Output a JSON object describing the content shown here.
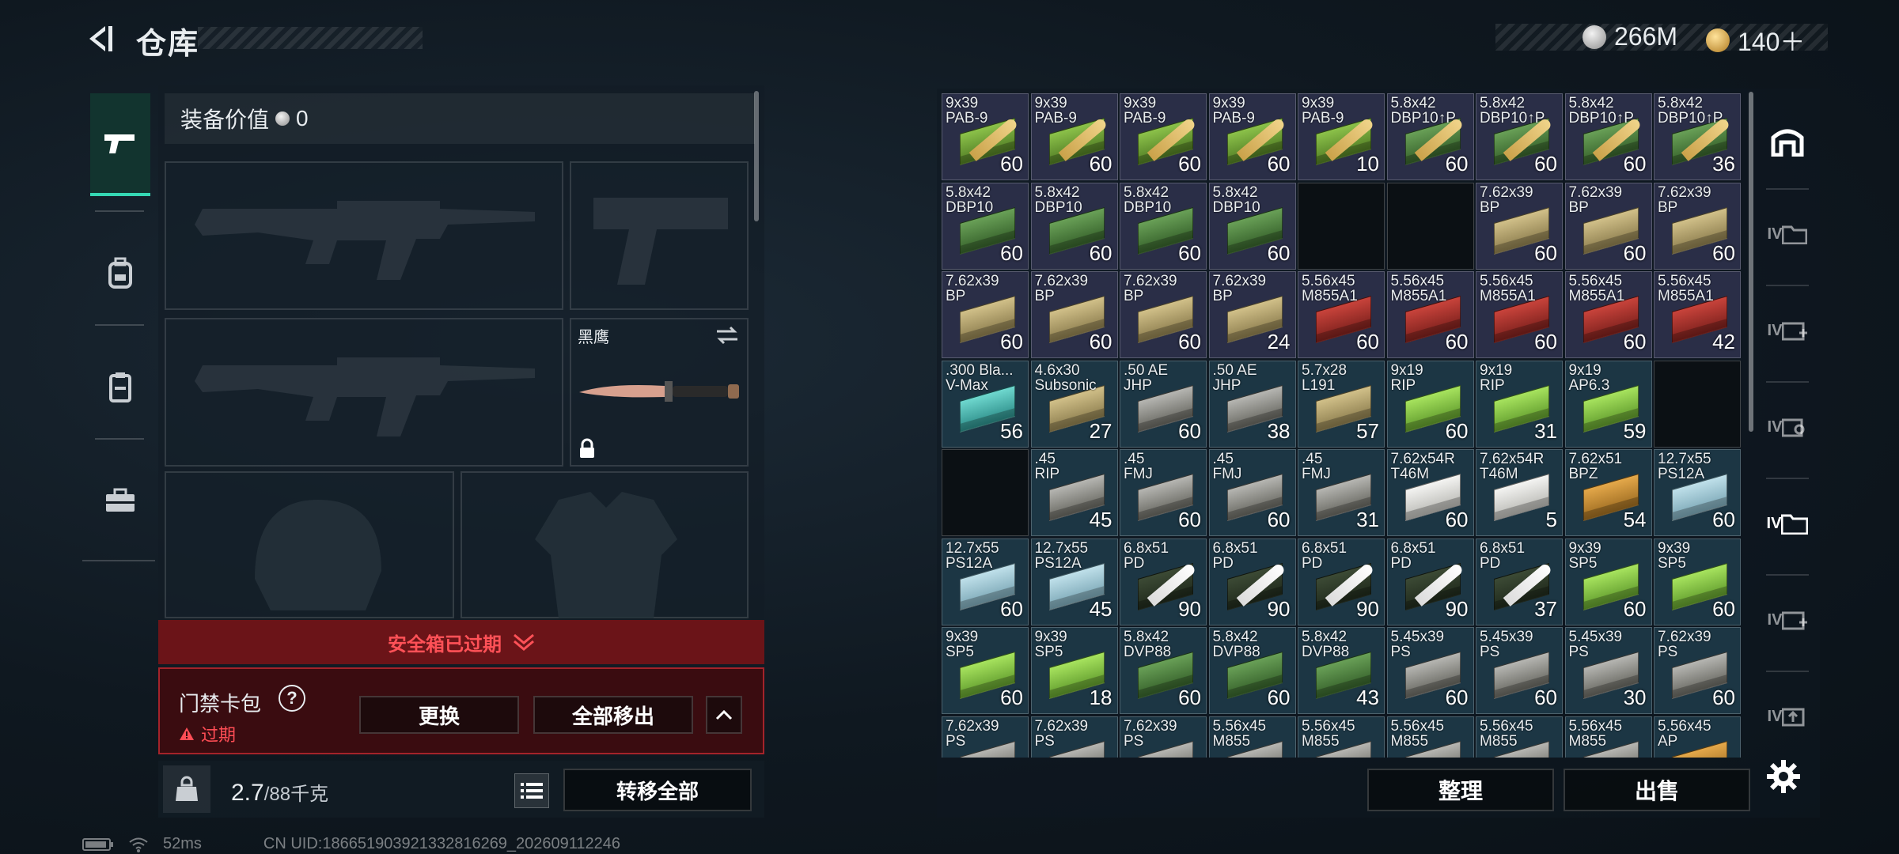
{
  "header": {
    "title": "仓库"
  },
  "currency": {
    "silver": {
      "icon": "silver-coin-icon",
      "value": "266M"
    },
    "gold": {
      "icon": "gold-coin-icon",
      "value": "140＋"
    }
  },
  "left_nav": [
    {
      "icon": "pistol-icon",
      "active": true
    },
    {
      "icon": "backpack-icon",
      "active": false
    },
    {
      "icon": "clipboard-icon",
      "active": false
    },
    {
      "icon": "toolbox-icon",
      "active": false
    }
  ],
  "loadout": {
    "value_label": "装备价值",
    "value": "0",
    "knife_label": "黑鹰"
  },
  "safebox": {
    "expired_text": "安全箱已过期"
  },
  "keybag": {
    "title": "门禁卡包",
    "help": "?",
    "status": "过期",
    "replace_label": "更换",
    "move_all_label": "全部移出"
  },
  "weight": {
    "current": "2.7",
    "max": "/88千克",
    "icon_label": "KG"
  },
  "transfer_all_label": "转移全部",
  "status_bar": {
    "ping": "52ms",
    "uid": "CN UID:186651903921332816269_202609112246"
  },
  "grid_actions": {
    "sort_label": "整理",
    "sell_label": "出售"
  },
  "right_nav": [
    {
      "icon": "safebox-icon",
      "label": ""
    },
    {
      "icon": "storage-iv-icon",
      "label": "IV"
    },
    {
      "icon": "storage-add-icon",
      "label": "IV"
    },
    {
      "icon": "storage-search-icon",
      "label": "IV"
    },
    {
      "icon": "storage-active-icon",
      "label": "IV"
    },
    {
      "icon": "storage-add-2-icon",
      "label": "IV"
    },
    {
      "icon": "storage-upload-icon",
      "label": "IV"
    }
  ],
  "inventory": [
    {
      "name": "9x39\nPAB-9",
      "qty": "60",
      "color": "purple",
      "box": "g",
      "bullet": "gold"
    },
    {
      "name": "9x39\nPAB-9",
      "qty": "60",
      "color": "purple",
      "box": "g",
      "bullet": "gold"
    },
    {
      "name": "9x39\nPAB-9",
      "qty": "60",
      "color": "purple",
      "box": "g",
      "bullet": "gold"
    },
    {
      "name": "9x39\nPAB-9",
      "qty": "60",
      "color": "purple",
      "box": "g",
      "bullet": "gold"
    },
    {
      "name": "9x39\nPAB-9",
      "qty": "10",
      "color": "purple",
      "box": "g",
      "bullet": "gold"
    },
    {
      "name": "5.8x42\nDBP10↑P",
      "qty": "60",
      "color": "purple",
      "box": "dg",
      "bullet": "gold"
    },
    {
      "name": "5.8x42\nDBP10↑P",
      "qty": "60",
      "color": "purple",
      "box": "dg",
      "bullet": "gold"
    },
    {
      "name": "5.8x42\nDBP10↑P",
      "qty": "60",
      "color": "purple",
      "box": "dg",
      "bullet": "gold"
    },
    {
      "name": "5.8x42\nDBP10↑P",
      "qty": "36",
      "color": "purple",
      "box": "dg",
      "bullet": "gold"
    },
    {
      "name": "5.8x42\nDBP10",
      "qty": "60",
      "color": "purple",
      "box": "dg"
    },
    {
      "name": "5.8x42\nDBP10",
      "qty": "60",
      "color": "purple",
      "box": "dg"
    },
    {
      "name": "5.8x42\nDBP10",
      "qty": "60",
      "color": "purple",
      "box": "dg"
    },
    {
      "name": "5.8x42\nDBP10",
      "qty": "60",
      "color": "purple",
      "box": "dg"
    },
    {
      "name": "",
      "qty": "",
      "color": "empty"
    },
    {
      "name": "",
      "qty": "",
      "color": "empty"
    },
    {
      "name": "7.62x39\nBP",
      "qty": "60",
      "color": "purple",
      "box": "t"
    },
    {
      "name": "7.62x39\nBP",
      "qty": "60",
      "color": "purple",
      "box": "t"
    },
    {
      "name": "7.62x39\nBP",
      "qty": "60",
      "color": "purple",
      "box": "t"
    },
    {
      "name": "7.62x39\nBP",
      "qty": "60",
      "color": "purple",
      "box": "t"
    },
    {
      "name": "7.62x39\nBP",
      "qty": "60",
      "color": "purple",
      "box": "t"
    },
    {
      "name": "7.62x39\nBP",
      "qty": "60",
      "color": "purple",
      "box": "t"
    },
    {
      "name": "7.62x39\nBP",
      "qty": "24",
      "color": "purple",
      "box": "t"
    },
    {
      "name": "5.56x45\nM855A1",
      "qty": "60",
      "color": "purple",
      "box": "r"
    },
    {
      "name": "5.56x45\nM855A1",
      "qty": "60",
      "color": "purple",
      "box": "r"
    },
    {
      "name": "5.56x45\nM855A1",
      "qty": "60",
      "color": "purple",
      "box": "r"
    },
    {
      "name": "5.56x45\nM855A1",
      "qty": "60",
      "color": "purple",
      "box": "r"
    },
    {
      "name": "5.56x45\nM855A1",
      "qty": "42",
      "color": "purple",
      "box": "r"
    },
    {
      "name": ".300 Bla...\nV-Max",
      "qty": "56",
      "color": "blue",
      "box": "tl"
    },
    {
      "name": "4.6x30\nSubsonic",
      "qty": "27",
      "color": "blue",
      "box": "t"
    },
    {
      "name": ".50 AE\nJHP",
      "qty": "60",
      "color": "blue",
      "box": "gr"
    },
    {
      "name": ".50 AE\nJHP",
      "qty": "38",
      "color": "blue",
      "box": "gr"
    },
    {
      "name": "5.7x28\nL191",
      "qty": "57",
      "color": "blue",
      "box": "t"
    },
    {
      "name": "9x19\nRIP",
      "qty": "60",
      "color": "blue",
      "box": "lg"
    },
    {
      "name": "9x19\nRIP",
      "qty": "31",
      "color": "blue",
      "box": "lg"
    },
    {
      "name": "9x19\nAP6.3",
      "qty": "59",
      "color": "blue",
      "box": "lg"
    },
    {
      "name": "",
      "qty": "",
      "color": "empty"
    },
    {
      "name": "",
      "qty": "",
      "color": "empty"
    },
    {
      "name": ".45\nRIP",
      "qty": "45",
      "color": "blue",
      "box": "gr"
    },
    {
      "name": ".45\nFMJ",
      "qty": "60",
      "color": "blue",
      "box": "gr"
    },
    {
      "name": ".45\nFMJ",
      "qty": "60",
      "color": "blue",
      "box": "gr"
    },
    {
      "name": ".45\nFMJ",
      "qty": "31",
      "color": "blue",
      "box": "gr"
    },
    {
      "name": "7.62x54R\nT46M",
      "qty": "60",
      "color": "blue",
      "box": "w"
    },
    {
      "name": "7.62x54R\nT46M",
      "qty": "5",
      "color": "blue",
      "box": "w"
    },
    {
      "name": "7.62x51\nBPZ",
      "qty": "54",
      "color": "blue",
      "box": "o"
    },
    {
      "name": "12.7x55\nPS12A",
      "qty": "60",
      "color": "blue",
      "box": "lb"
    },
    {
      "name": "12.7x55\nPS12A",
      "qty": "60",
      "color": "blue",
      "box": "lb"
    },
    {
      "name": "12.7x55\nPS12A",
      "qty": "45",
      "color": "blue",
      "box": "lb"
    },
    {
      "name": "6.8x51\nPD",
      "qty": "90",
      "color": "blue",
      "box": "dk",
      "bullet": "white"
    },
    {
      "name": "6.8x51\nPD",
      "qty": "90",
      "color": "blue",
      "box": "dk",
      "bullet": "white"
    },
    {
      "name": "6.8x51\nPD",
      "qty": "90",
      "color": "blue",
      "box": "dk",
      "bullet": "white"
    },
    {
      "name": "6.8x51\nPD",
      "qty": "90",
      "color": "blue",
      "box": "dk",
      "bullet": "white"
    },
    {
      "name": "6.8x51\nPD",
      "qty": "37",
      "color": "blue",
      "box": "dk",
      "bullet": "white"
    },
    {
      "name": "9x39\nSP5",
      "qty": "60",
      "color": "blue",
      "box": "lg"
    },
    {
      "name": "9x39\nSP5",
      "qty": "60",
      "color": "blue",
      "box": "lg"
    },
    {
      "name": "9x39\nSP5",
      "qty": "60",
      "color": "blue",
      "box": "lg"
    },
    {
      "name": "9x39\nSP5",
      "qty": "18",
      "color": "blue",
      "box": "lg"
    },
    {
      "name": "5.8x42\nDVP88",
      "qty": "60",
      "color": "blue",
      "box": "dg"
    },
    {
      "name": "5.8x42\nDVP88",
      "qty": "60",
      "color": "blue",
      "box": "dg"
    },
    {
      "name": "5.8x42\nDVP88",
      "qty": "43",
      "color": "blue",
      "box": "dg"
    },
    {
      "name": "5.45x39\nPS",
      "qty": "60",
      "color": "blue",
      "box": "gr"
    },
    {
      "name": "5.45x39\nPS",
      "qty": "60",
      "color": "blue",
      "box": "gr"
    },
    {
      "name": "5.45x39\nPS",
      "qty": "30",
      "color": "blue",
      "box": "gr"
    },
    {
      "name": "7.62x39\nPS",
      "qty": "60",
      "color": "blue",
      "box": "gr"
    },
    {
      "name": "7.62x39\nPS",
      "qty": "",
      "color": "blue",
      "box": "gr"
    },
    {
      "name": "7.62x39\nPS",
      "qty": "",
      "color": "blue",
      "box": "gr"
    },
    {
      "name": "7.62x39\nPS",
      "qty": "",
      "color": "blue",
      "box": "gr"
    },
    {
      "name": "5.56x45\nM855",
      "qty": "",
      "color": "blue",
      "box": "gr"
    },
    {
      "name": "5.56x45\nM855",
      "qty": "",
      "color": "blue",
      "box": "gr"
    },
    {
      "name": "5.56x45\nM855",
      "qty": "",
      "color": "blue",
      "box": "gr"
    },
    {
      "name": "5.56x45\nM855",
      "qty": "",
      "color": "blue",
      "box": "gr"
    },
    {
      "name": "5.56x45\nM855",
      "qty": "",
      "color": "blue",
      "box": "gr"
    },
    {
      "name": "5.56x45\nAP",
      "qty": "",
      "color": "blue",
      "box": "o"
    }
  ]
}
